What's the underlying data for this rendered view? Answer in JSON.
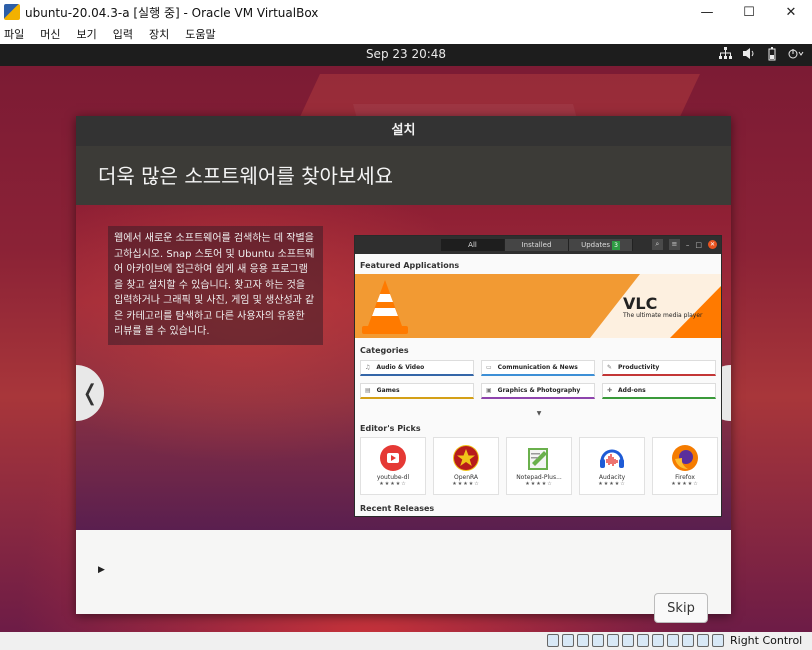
{
  "window": {
    "title": "ubuntu-20.04.3-a [실행 중] - Oracle VM VirtualBox",
    "controls": [
      "—",
      "☐",
      "✕"
    ]
  },
  "menubar": {
    "items": [
      "파일",
      "머신",
      "보기",
      "입력",
      "장치",
      "도움말"
    ]
  },
  "topbar": {
    "clock": "Sep 23  20:48",
    "tray_icons": [
      "network-icon",
      "volume-icon",
      "battery-icon",
      "power-menu-icon"
    ]
  },
  "installer": {
    "header_title": "설치",
    "heading": "더욱 많은 소프트웨어를 찾아보세요",
    "description": "웹에서 새로운 소프트웨어를 검색하는 데 작별을 고하십시오. Snap 스토어 및 Ubuntu 소프트웨어 아카이브에 접근하여 쉽게 새 응용 프로그램을 찾고 설치할 수 있습니다. 찾고자 하는 것을 입력하거나 그래픽 및 사진, 게임 및 생산성과 같은 카테고리를 탐색하고 다른 사용자의 유용한 리뷰를 볼 수 있습니다.",
    "nav_prev": "❬",
    "nav_next": "❭",
    "skip_label": "Skip",
    "progress_fraction": 0.11
  },
  "software_window": {
    "tabs": [
      "All",
      "Installed",
      "Updates"
    ],
    "updates_count": "3",
    "featured_title": "Featured Applications",
    "banner_title": "VLC",
    "banner_subtitle": "The ultimate media player",
    "categories_title": "Categories",
    "categories": [
      {
        "label": "Audio & Video",
        "icon": "music-icon",
        "color": "#3466a8"
      },
      {
        "label": "Communication & News",
        "icon": "chat-icon",
        "color": "#3c8fd6"
      },
      {
        "label": "Productivity",
        "icon": "productivity-icon",
        "color": "#c33636"
      },
      {
        "label": "Games",
        "icon": "games-icon",
        "color": "#d4a017"
      },
      {
        "label": "Graphics & Photography",
        "icon": "graphics-icon",
        "color": "#8e44ad"
      },
      {
        "label": "Add-ons",
        "icon": "addons-icon",
        "color": "#3a9a3a"
      }
    ],
    "picks_title": "Editor's Picks",
    "picks": [
      {
        "name": "youtube-dl",
        "icon": "youtube-dl-icon",
        "color": "#e53935",
        "stars": "★★★★☆"
      },
      {
        "name": "OpenRA",
        "icon": "openra-icon",
        "color": "#b71c1c",
        "stars": "★★★★☆"
      },
      {
        "name": "Notepad-Plus...",
        "icon": "notepad-plus-icon",
        "color": "#6ab04c",
        "stars": "★★★★☆"
      },
      {
        "name": "Audacity",
        "icon": "audacity-icon",
        "color": "#1e5bd6",
        "stars": "★★★★☆"
      },
      {
        "name": "Firefox",
        "icon": "firefox-icon",
        "color": "#f57c00",
        "stars": "★★★★☆"
      }
    ],
    "recent_title": "Recent Releases"
  },
  "statusbar": {
    "host_key": "Right Control"
  }
}
